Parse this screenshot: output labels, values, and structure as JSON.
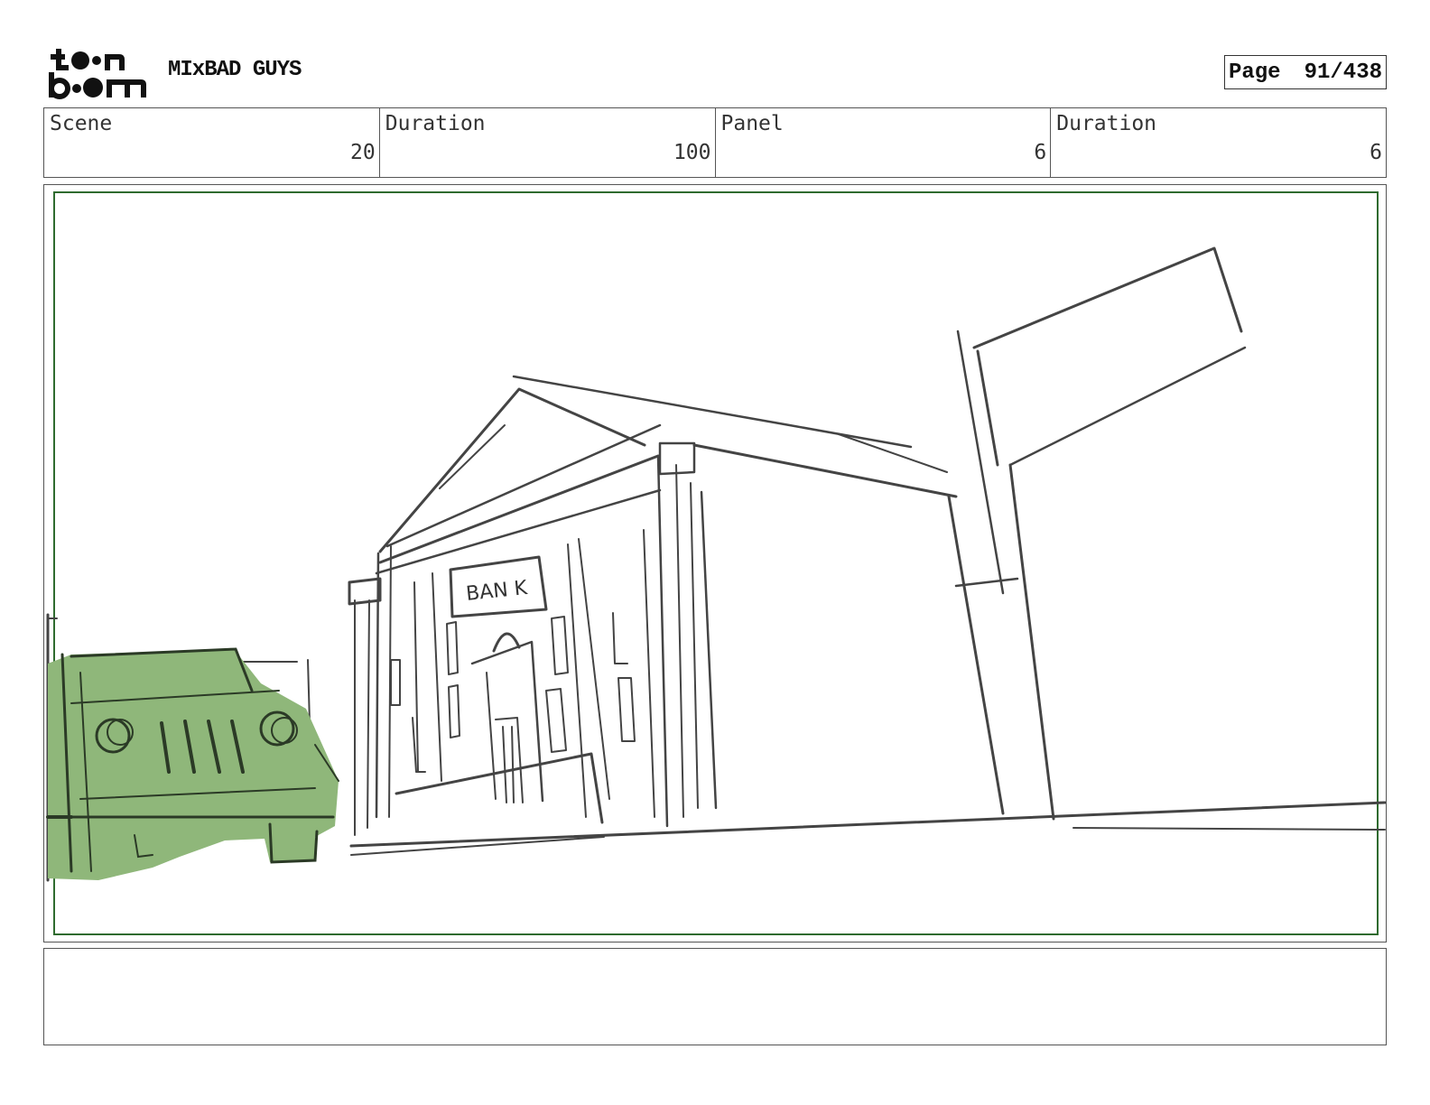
{
  "header": {
    "project_title": "MIxBAD GUYS",
    "page_label": "Page",
    "page_value": "91/438"
  },
  "info": {
    "scene_label": "Scene",
    "scene_value": "20",
    "scene_duration_label": "Duration",
    "scene_duration_value": "100",
    "panel_label": "Panel",
    "panel_value": "6",
    "panel_duration_label": "Duration",
    "panel_duration_value": "6"
  },
  "sketch": {
    "sign_text": "BAN K",
    "car_fill": "#8fb77a",
    "safe_frame_color": "#2f6b2f"
  },
  "notes": {
    "text": ""
  }
}
